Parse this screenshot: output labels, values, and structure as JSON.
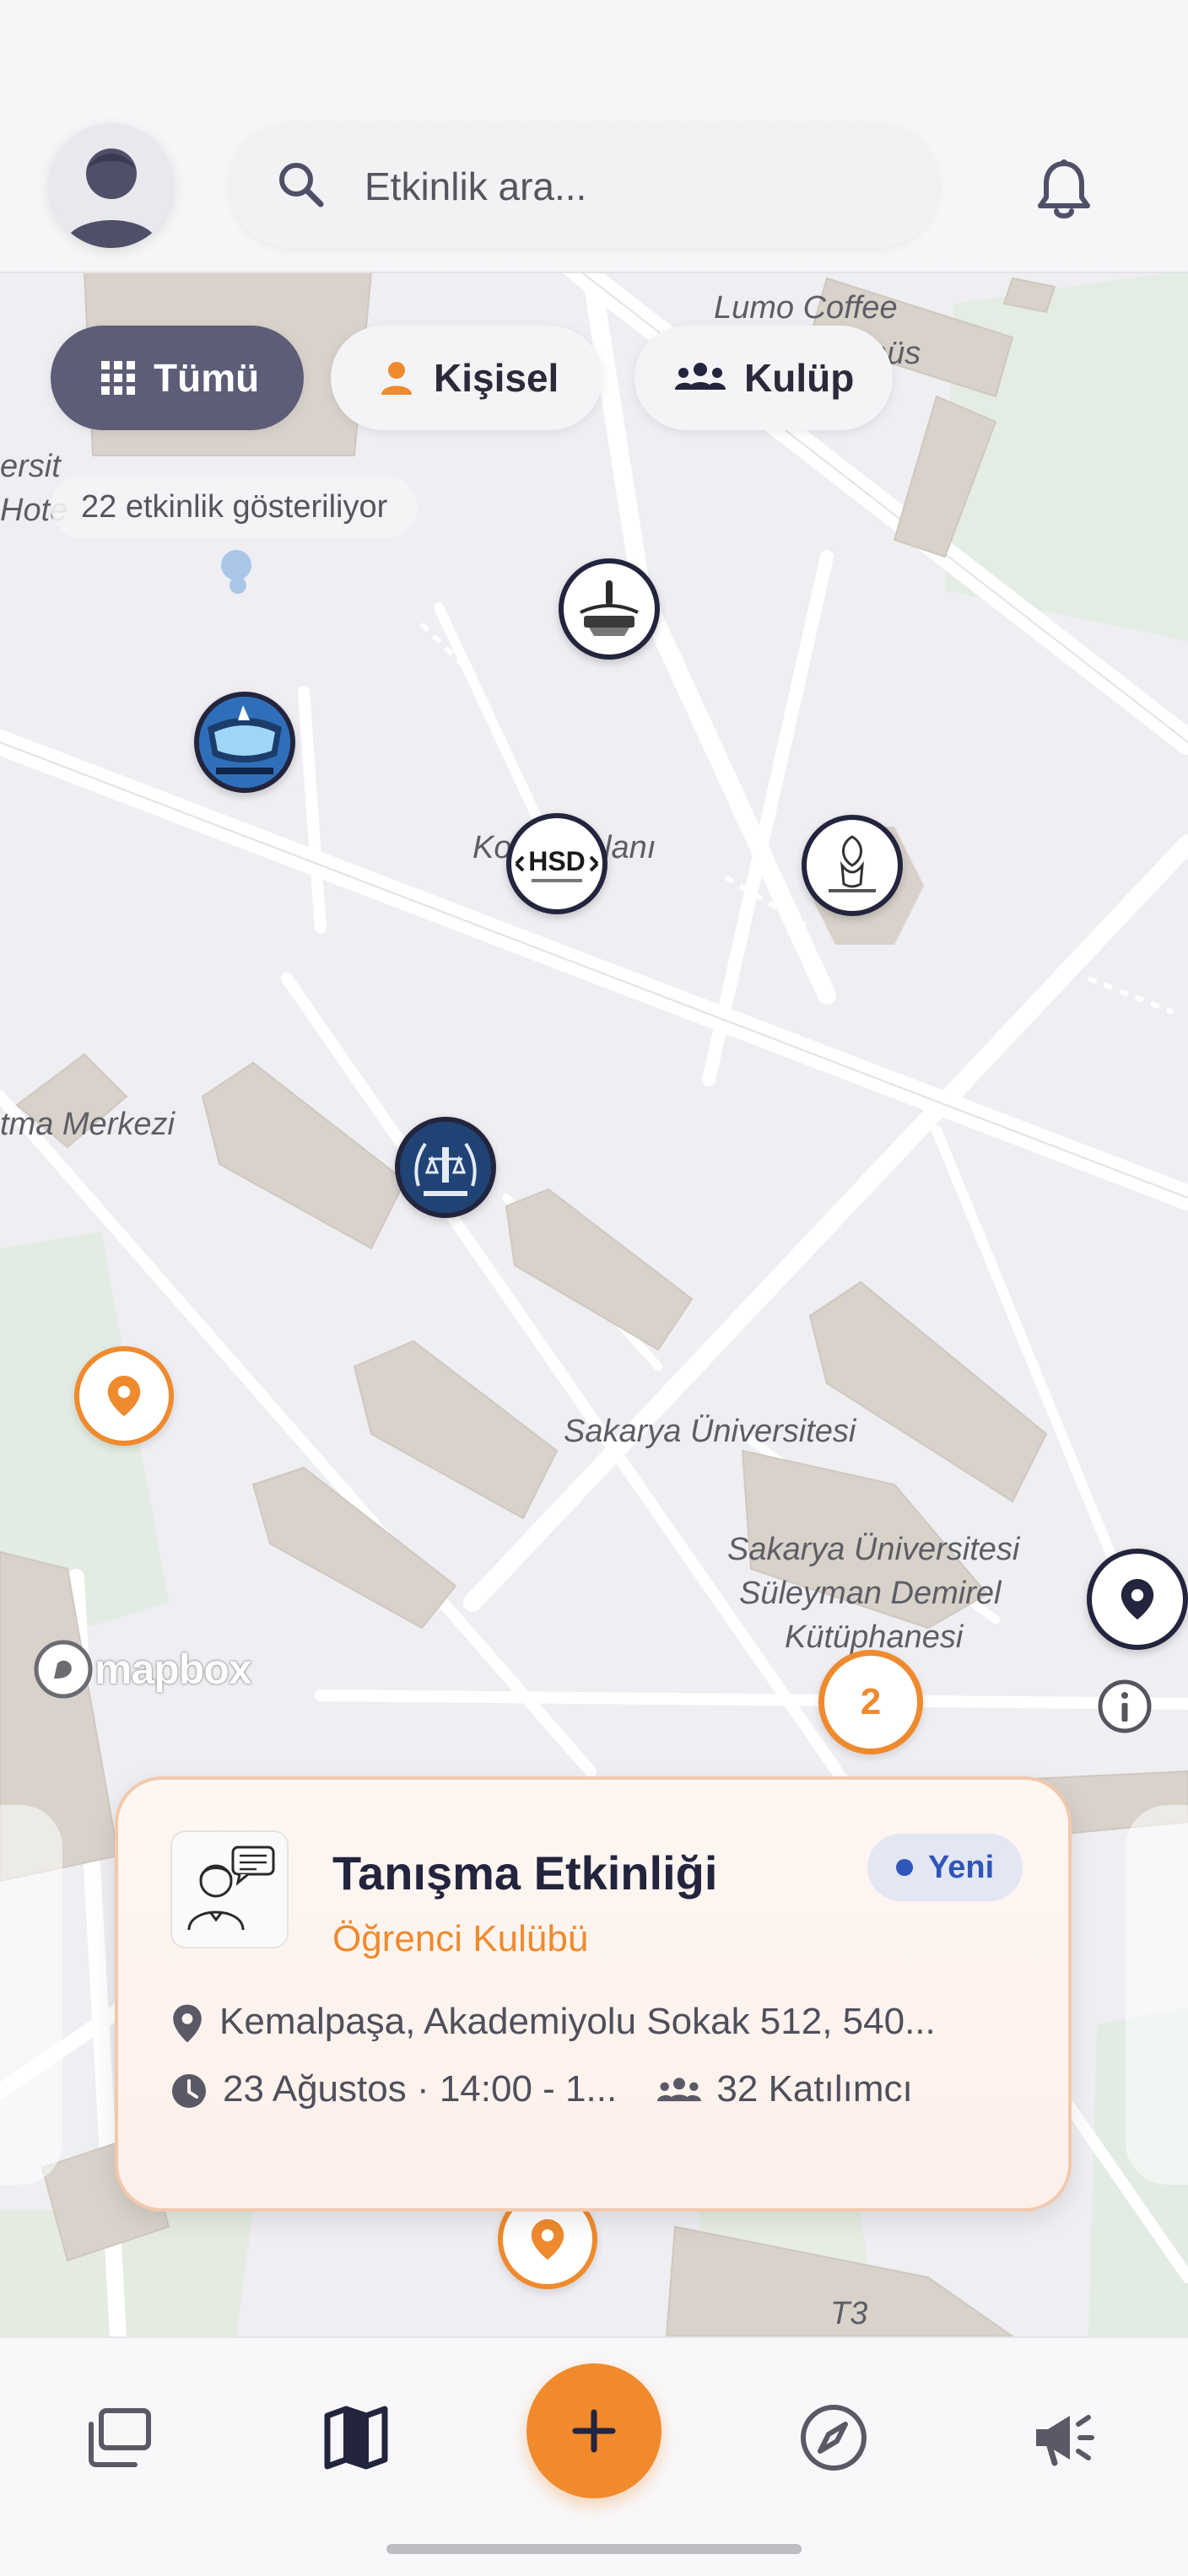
{
  "search": {
    "placeholder": "Etkinlik ara..."
  },
  "filters": {
    "all_label": "Tümü",
    "personal_label": "Kişisel",
    "club_label": "Kulüp"
  },
  "event_count_text": "22 etkinlik gösteriliyor",
  "map": {
    "labels": {
      "lumo_coffee": "Lumo Coffee",
      "hus": "hüs",
      "versity_hotel_1": "ersit",
      "versity_hotel_2": "Hote",
      "kongre_alani_a": "Ko",
      "kongre_alani_b": "lanı",
      "merkez": "tma Merkezi",
      "sakarya_uni": "Sakarya Üniversitesi",
      "library_1": "Sakarya Üniversitesi",
      "library_2": "Süleyman Demirel",
      "library_3": "Kütüphanesi",
      "t3": "T3"
    },
    "attribution": "mapbox",
    "cluster_count": "2",
    "hsd_marker_text": "HSD"
  },
  "event_card": {
    "title": "Tanışma Etkinliği",
    "organizer": "Öğrenci Kulübü",
    "badge": "Yeni",
    "location": "Kemalpaşa, Akademiyolu Sokak 512, 540...",
    "datetime": "23 Ağustos · 14:00 - 1...",
    "participants": "32 Katılımcı"
  },
  "colors": {
    "accent": "#ef8a2e",
    "navy": "#23243d",
    "chip_active": "#5d5d78",
    "badge_blue": "#2f56b8"
  },
  "icons": {
    "nav": [
      "cards-icon",
      "map-icon",
      "plus-icon",
      "compass-icon",
      "megaphone-icon"
    ]
  }
}
